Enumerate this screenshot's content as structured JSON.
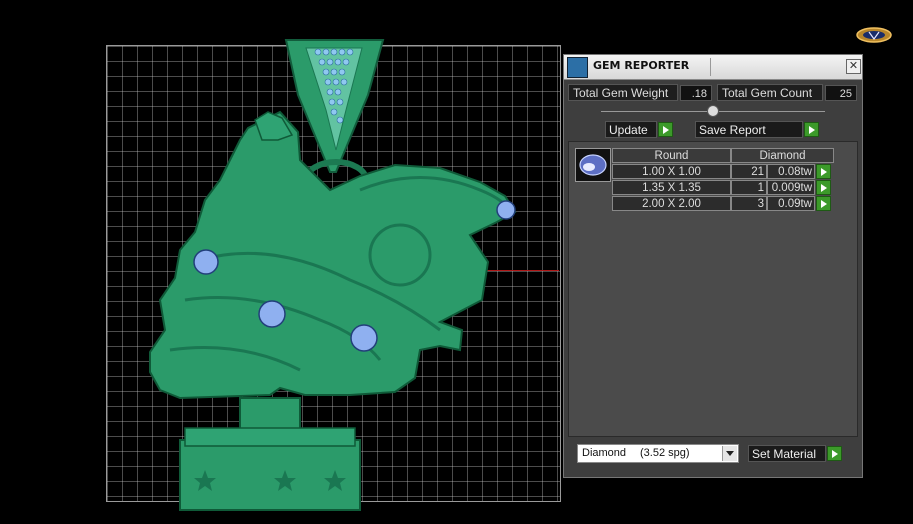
{
  "panel": {
    "title": "GEM REPORTER",
    "close_symbol": "✕",
    "total_weight_label": "Total Gem Weight",
    "total_weight_value": ".18",
    "total_count_label": "Total Gem Count",
    "total_count_value": "25",
    "update_label": "Update",
    "save_report_label": "Save Report",
    "set_material_label": "Set Material",
    "material": {
      "name": "Diamond",
      "spg": "(3.52 spg)"
    }
  },
  "table": {
    "shape_header": "Round",
    "material_header": "Diamond",
    "rows": [
      {
        "size": "1.00 X 1.00",
        "count": "21",
        "weight": "0.08tw"
      },
      {
        "size": "1.35 X 1.35",
        "count": "1",
        "weight": "0.009tw"
      },
      {
        "size": "2.00 X 2.00",
        "count": "3",
        "weight": "0.09tw"
      }
    ]
  },
  "colors": {
    "model_green": "#2b9b6a",
    "accent_green": "#3c9a2a",
    "axis_red": "#b01818"
  },
  "icons": [
    "app-icon",
    "close-icon",
    "gem-thumbnail-icon",
    "play-arrow-icon",
    "dropdown-arrow-icon",
    "logo-icon"
  ]
}
